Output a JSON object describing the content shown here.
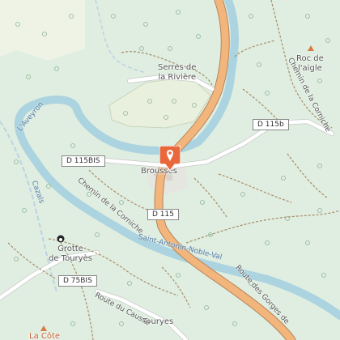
{
  "map": {
    "places": {
      "serres": [
        "Serres de",
        "la Rivière"
      ],
      "roc": [
        "Roc de",
        "l'aigle"
      ],
      "brousses": "Brousses",
      "grotte": [
        "Grotte",
        "de Touryès"
      ],
      "touryes": "Touryes",
      "la_cote": "La Côte"
    },
    "roads": {
      "d115b": "D 115b",
      "d115bis": "D 115BIS",
      "d115": "D 115",
      "d75bis": "D 75BIS"
    },
    "street_names": {
      "chemin_roc": "Chemin de la Corniche",
      "chemin_corniche": "Chemin de la Corniche",
      "route_causse": "Route du Causse",
      "route_gorges": "Route des Gorges de",
      "saint_antonin": "Saint-Antonin-Noble-Val"
    },
    "water": {
      "aveyron": "L'Aveyron",
      "cazals": "Cazals"
    },
    "colors": {
      "forest": "#dfeee0",
      "river": "#abd3e0",
      "main_road": "#f2b57c",
      "marker": "#e8683c"
    }
  }
}
